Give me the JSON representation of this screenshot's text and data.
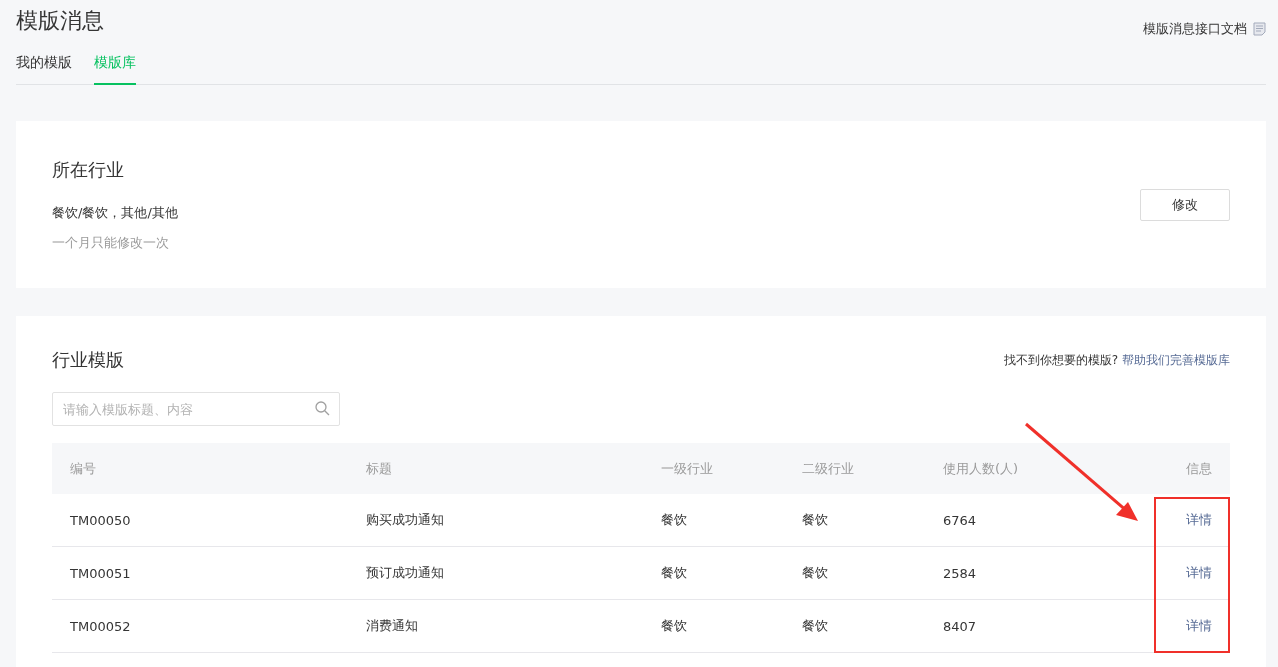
{
  "page_title": "模版消息",
  "doc_link": "模版消息接口文档",
  "tabs": [
    {
      "label": "我的模版",
      "selected": false
    },
    {
      "label": "模版库",
      "selected": true
    }
  ],
  "industry_card": {
    "title": "所在行业",
    "value": "餐饮/餐饮，其他/其他",
    "note": "一个月只能修改一次",
    "button": "修改"
  },
  "templates_card": {
    "title": "行业模版",
    "hint": "找不到你想要的模版?",
    "hint_link": "帮助我们完善模版库",
    "search": {
      "placeholder": "请输入模版标题、内容"
    },
    "table": {
      "columns": [
        "编号",
        "标题",
        "一级行业",
        "二级行业",
        "使用人数(人)",
        "信息"
      ],
      "rows": [
        {
          "cells": [
            "TM00050",
            "购买成功通知",
            "餐饮",
            "餐饮",
            "6764"
          ],
          "action": "详情"
        },
        {
          "cells": [
            "TM00051",
            "预订成功通知",
            "餐饮",
            "餐饮",
            "2584"
          ],
          "action": "详情"
        },
        {
          "cells": [
            "TM00052",
            "消费通知",
            "餐饮",
            "餐饮",
            "8407"
          ],
          "action": "详情"
        }
      ]
    }
  }
}
